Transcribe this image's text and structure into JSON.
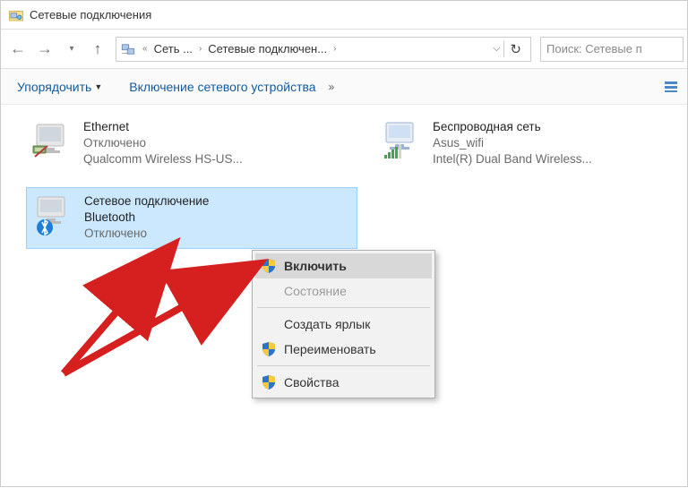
{
  "window": {
    "title": "Сетевые подключения"
  },
  "breadcrumb": {
    "seg1": "Сеть ...",
    "seg2": "Сетевые подключен..."
  },
  "search": {
    "placeholder": "Поиск: Сетевые п"
  },
  "toolbar": {
    "organize": "Упорядочить",
    "enable_device": "Включение сетевого устройства"
  },
  "connections": {
    "ethernet": {
      "name": "Ethernet",
      "status": "Отключено",
      "device": "Qualcomm Wireless HS-US..."
    },
    "wifi": {
      "name": "Беспроводная сеть",
      "ssid": "Asus_wifi",
      "device": "Intel(R) Dual Band Wireless..."
    },
    "bluetooth": {
      "name_l1": "Сетевое подключение",
      "name_l2": "Bluetooth",
      "status": "Отключено"
    }
  },
  "context_menu": {
    "enable": "Включить",
    "status": "Состояние",
    "shortcut": "Создать ярлык",
    "rename": "Переименовать",
    "properties": "Свойства"
  }
}
